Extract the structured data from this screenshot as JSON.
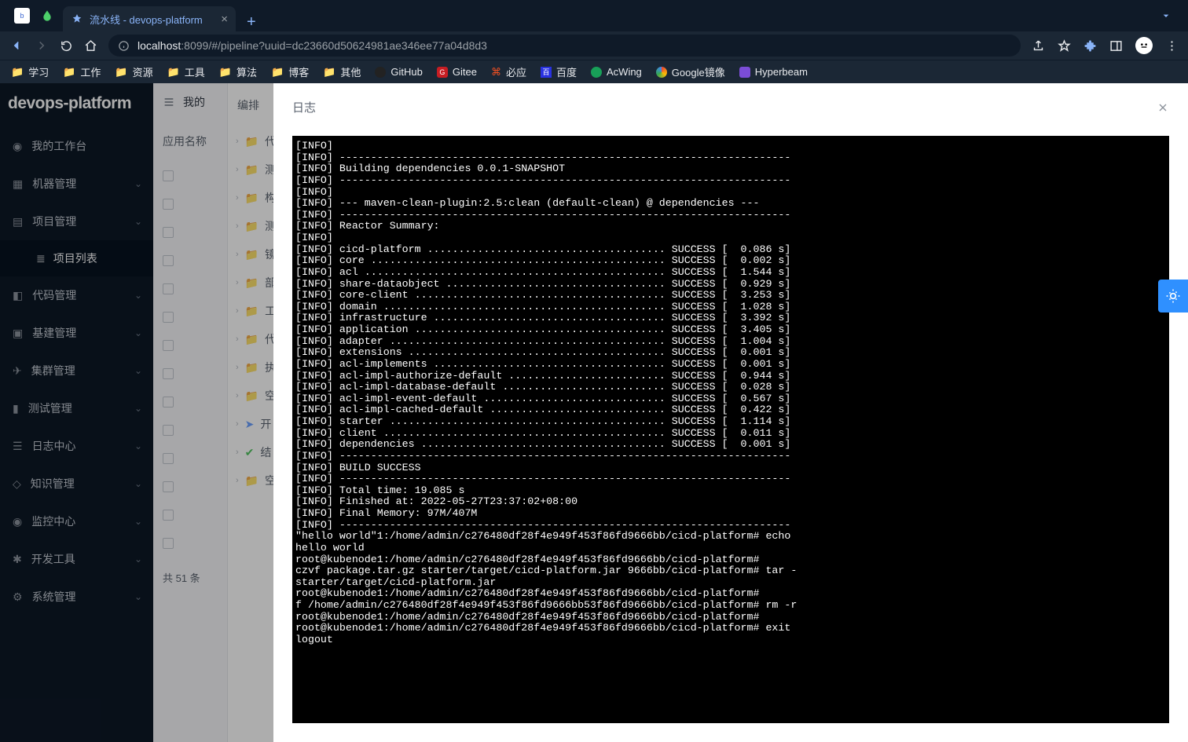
{
  "browser": {
    "tab_title": "流水线 - devops-platform",
    "url_host": "localhost",
    "url_port": ":8099",
    "url_path": "/#/pipeline?uuid=dc23660d50624981ae346ee77a04d8d3",
    "bookmarks": [
      "学习",
      "工作",
      "资源",
      "工具",
      "算法",
      "博客",
      "其他",
      "GitHub",
      "Gitee",
      "必应",
      "百度",
      "AcWing",
      "Google镜像",
      "Hyperbeam"
    ]
  },
  "app": {
    "brand": "devops-platform",
    "menu": [
      {
        "label": "我的工作台",
        "expandable": false
      },
      {
        "label": "机器管理",
        "expandable": true
      },
      {
        "label": "项目管理",
        "expandable": true,
        "sub": "项目列表"
      },
      {
        "label": "代码管理",
        "expandable": true
      },
      {
        "label": "基建管理",
        "expandable": true
      },
      {
        "label": "集群管理",
        "expandable": true
      },
      {
        "label": "测试管理",
        "expandable": true
      },
      {
        "label": "日志中心",
        "expandable": true
      },
      {
        "label": "知识管理",
        "expandable": true
      },
      {
        "label": "监控中心",
        "expandable": true
      },
      {
        "label": "开发工具",
        "expandable": true
      },
      {
        "label": "系统管理",
        "expandable": true
      }
    ],
    "panel1": {
      "header": "我的",
      "col": "应用名称",
      "footer": "共 51 条"
    },
    "drawer": {
      "header": "编排"
    },
    "stages": [
      "代",
      "测",
      "构",
      "测",
      "镜",
      "部",
      "工",
      "代",
      "执",
      "空",
      "开",
      "结",
      "空"
    ]
  },
  "modal": {
    "title": "日志",
    "log": "[INFO] \n[INFO] ------------------------------------------------------------------------\n[INFO] Building dependencies 0.0.1-SNAPSHOT\n[INFO] ------------------------------------------------------------------------\n[INFO] \n[INFO] --- maven-clean-plugin:2.5:clean (default-clean) @ dependencies ---\n[INFO] ------------------------------------------------------------------------\n[INFO] Reactor Summary:\n[INFO] \n[INFO] cicd-platform ...................................... SUCCESS [  0.086 s]\n[INFO] core ............................................... SUCCESS [  0.002 s]\n[INFO] acl ................................................ SUCCESS [  1.544 s]\n[INFO] share-dataobject ................................... SUCCESS [  0.929 s]\n[INFO] core-client ........................................ SUCCESS [  3.253 s]\n[INFO] domain ............................................. SUCCESS [  1.028 s]\n[INFO] infrastructure ..................................... SUCCESS [  3.392 s]\n[INFO] application ........................................ SUCCESS [  3.405 s]\n[INFO] adapter ............................................ SUCCESS [  1.004 s]\n[INFO] extensions ......................................... SUCCESS [  0.001 s]\n[INFO] acl-implements ..................................... SUCCESS [  0.001 s]\n[INFO] acl-impl-authorize-default ......................... SUCCESS [  0.944 s]\n[INFO] acl-impl-database-default .......................... SUCCESS [  0.028 s]\n[INFO] acl-impl-event-default ............................. SUCCESS [  0.567 s]\n[INFO] acl-impl-cached-default ............................ SUCCESS [  0.422 s]\n[INFO] starter ............................................ SUCCESS [  1.114 s]\n[INFO] client ............................................. SUCCESS [  0.011 s]\n[INFO] dependencies ....................................... SUCCESS [  0.001 s]\n[INFO] ------------------------------------------------------------------------\n[INFO] BUILD SUCCESS\n[INFO] ------------------------------------------------------------------------\n[INFO] Total time: 19.085 s\n[INFO] Finished at: 2022-05-27T23:37:02+08:00\n[INFO] Final Memory: 97M/407M\n[INFO] ------------------------------------------------------------------------\n\"hello world\"1:/home/admin/c276480df28f4e949f453f86fd9666bb/cicd-platform# echo \nhello world\nroot@kubenode1:/home/admin/c276480df28f4e949f453f86fd9666bb/cicd-platform# \nczvf package.tar.gz starter/target/cicd-platform.jar 9666bb/cicd-platform# tar -\nstarter/target/cicd-platform.jar\nroot@kubenode1:/home/admin/c276480df28f4e949f453f86fd9666bb/cicd-platform# \nf /home/admin/c276480df28f4e949f453f86fd9666bb53f86fd9666bb/cicd-platform# rm -r\nroot@kubenode1:/home/admin/c276480df28f4e949f453f86fd9666bb/cicd-platform# \nroot@kubenode1:/home/admin/c276480df28f4e949f453f86fd9666bb/cicd-platform# exit\nlogout"
  }
}
